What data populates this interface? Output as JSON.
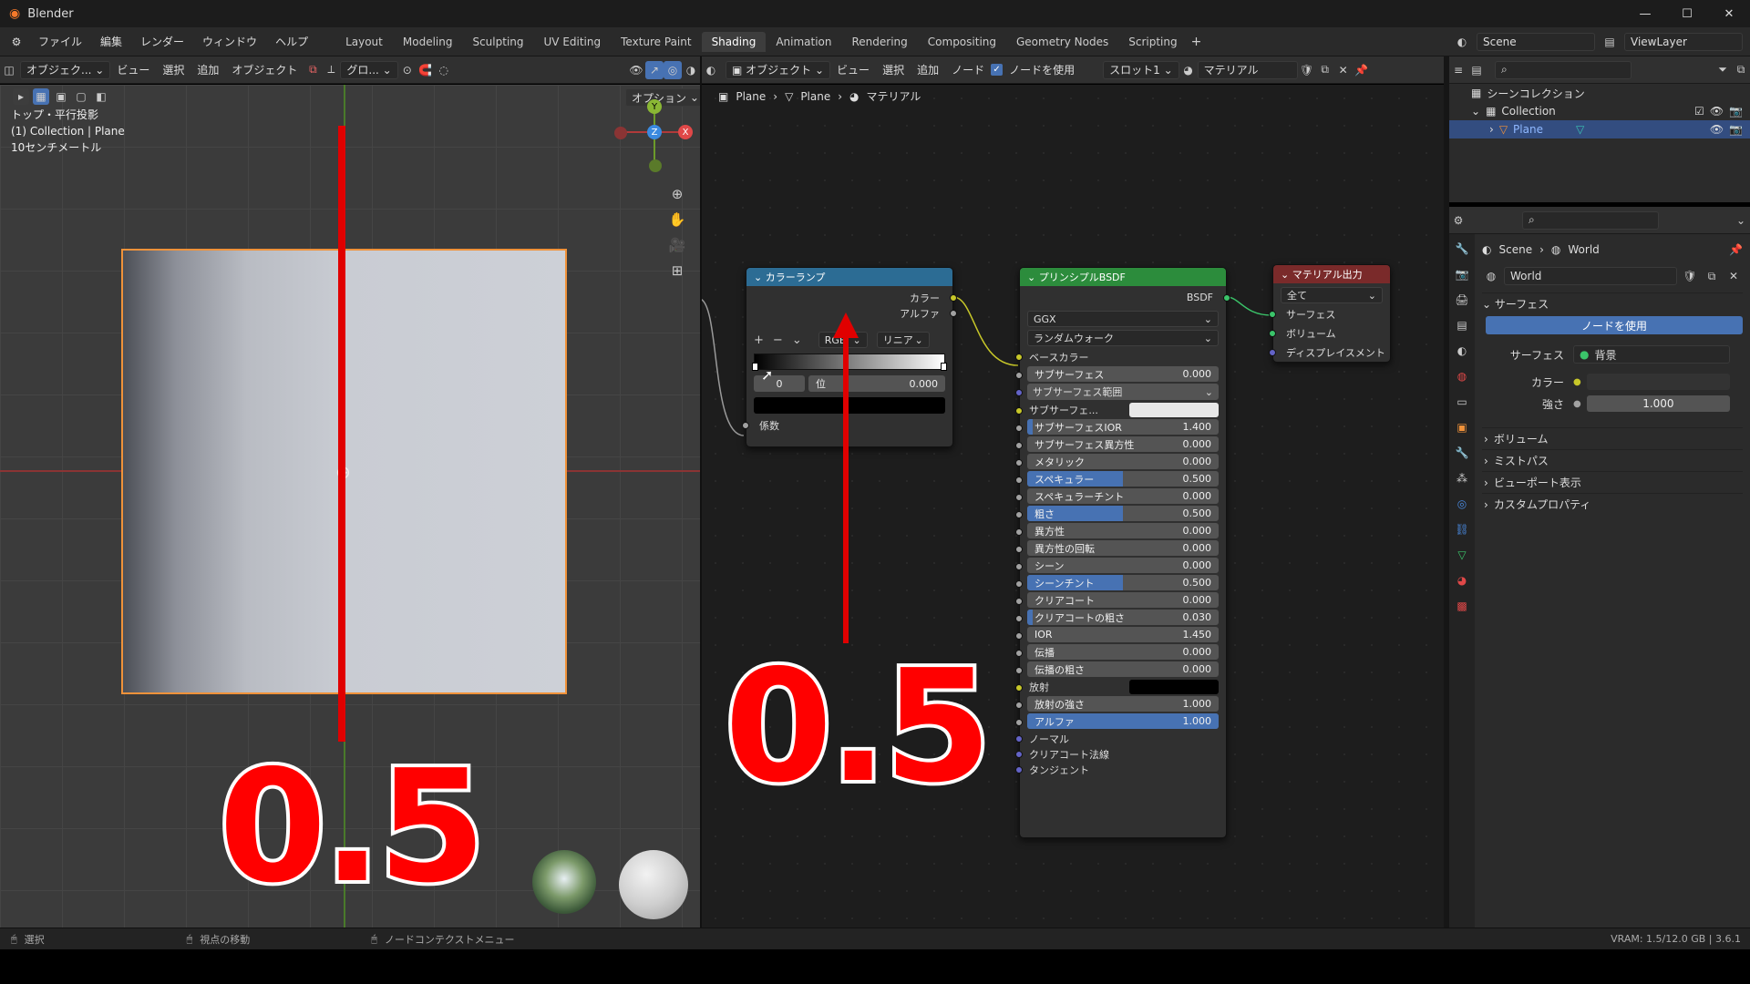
{
  "app_title": "Blender",
  "window_controls": {
    "minimize": "—",
    "maximize": "☐",
    "close": "✕"
  },
  "menu": {
    "items": [
      "ファイル",
      "編集",
      "レンダー",
      "ウィンドウ",
      "ヘルプ"
    ]
  },
  "workspace_tabs": [
    "Layout",
    "Modeling",
    "Sculpting",
    "UV Editing",
    "Texture Paint",
    "Shading",
    "Animation",
    "Rendering",
    "Compositing",
    "Geometry Nodes",
    "Scripting"
  ],
  "active_tab": "Shading",
  "add_tab": "+",
  "scene_name": "Scene",
  "view_layer": "ViewLayer",
  "viewport": {
    "header": {
      "mode": "オブジェク...",
      "view": "ビュー",
      "select": "選択",
      "add": "追加",
      "object": "オブジェクト",
      "transform": "グロ...",
      "options": "オプション"
    },
    "overlay_lines": [
      "トップ・平行投影",
      "(1) Collection | Plane",
      "10センチメートル"
    ],
    "gizmo": {
      "y": "Y",
      "z": "Z",
      "x": "X"
    },
    "annotation": "0.5"
  },
  "node_editor": {
    "header": {
      "object": "オブジェクト",
      "view": "ビュー",
      "select": "選択",
      "add": "追加",
      "node": "ノード",
      "use_nodes": "ノードを使用",
      "slot": "スロット1",
      "material": "マテリアル"
    },
    "breadcrumb": [
      "Plane",
      "Plane",
      "マテリアル"
    ],
    "annotation": "0.5",
    "color_ramp": {
      "title": "カラーランプ",
      "outputs": [
        "カラー",
        "アルファ"
      ],
      "controls": {
        "plus": "+",
        "minus": "−",
        "color_mode": "RGB",
        "interpolation": "リニア"
      },
      "stop_index": "0",
      "stop_pos_label": "位",
      "stop_pos_value": "0.000",
      "input": "係数"
    },
    "bsdf": {
      "title": "プリンシプルBSDF",
      "output": "BSDF",
      "distribution": "GGX",
      "subsurface_method": "ランダムウォーク",
      "base_color": "ベースカラー",
      "fields": [
        {
          "label": "サブサーフェス",
          "value": "0.000",
          "fill": 0
        },
        {
          "label": "サブサーフェス範囲",
          "value": "",
          "fill": 0,
          "dropdown": true
        },
        {
          "label": "サブサーフェ...",
          "value": "",
          "fill": 0,
          "swatch": "#e8e8e8"
        },
        {
          "label": "サブサーフェスIOR",
          "value": "1.400",
          "fill": 0.03
        },
        {
          "label": "サブサーフェス異方性",
          "value": "0.000",
          "fill": 0
        },
        {
          "label": "メタリック",
          "value": "0.000",
          "fill": 0
        },
        {
          "label": "スペキュラー",
          "value": "0.500",
          "fill": 0.5
        },
        {
          "label": "スペキュラーチント",
          "value": "0.000",
          "fill": 0
        },
        {
          "label": "粗さ",
          "value": "0.500",
          "fill": 0.5
        },
        {
          "label": "異方性",
          "value": "0.000",
          "fill": 0
        },
        {
          "label": "異方性の回転",
          "value": "0.000",
          "fill": 0
        },
        {
          "label": "シーン",
          "value": "0.000",
          "fill": 0
        },
        {
          "label": "シーンチント",
          "value": "0.500",
          "fill": 0.5
        },
        {
          "label": "クリアコート",
          "value": "0.000",
          "fill": 0
        },
        {
          "label": "クリアコートの粗さ",
          "value": "0.030",
          "fill": 0.03
        },
        {
          "label": "IOR",
          "value": "1.450",
          "fill": 0
        },
        {
          "label": "伝播",
          "value": "0.000",
          "fill": 0
        },
        {
          "label": "伝播の粗さ",
          "value": "0.000",
          "fill": 0
        },
        {
          "label": "放射",
          "value": "",
          "fill": 0,
          "swatch": "#000000"
        },
        {
          "label": "放射の強さ",
          "value": "1.000",
          "fill": 0
        },
        {
          "label": "アルファ",
          "value": "1.000",
          "fill": 1
        }
      ],
      "bottom_inputs": [
        "ノーマル",
        "クリアコート法線",
        "タンジェント"
      ]
    },
    "output": {
      "title": "マテリアル出力",
      "target": "全て",
      "inputs": [
        "サーフェス",
        "ボリューム",
        "ディスプレイスメント"
      ]
    }
  },
  "outliner": {
    "root": "シーンコレクション",
    "collection": "Collection",
    "object": "Plane"
  },
  "properties": {
    "breadcrumb": [
      "Scene",
      "World"
    ],
    "world_name": "World",
    "panel_surface": "サーフェス",
    "use_nodes": "ノードを使用",
    "surface_label": "サーフェス",
    "surface_value": "背景",
    "color_label": "カラー",
    "strength_label": "強さ",
    "strength_value": "1.000",
    "collapsed_panels": [
      "ボリューム",
      "ミストパス",
      "ビューポート表示",
      "カスタムプロパティ"
    ]
  },
  "status": {
    "select": "選択",
    "move_view": "視点の移動",
    "node_ctx": "ノードコンテクストメニュー",
    "vram": "VRAM: 1.5/12.0 GB | 3.6.1"
  },
  "colors": {
    "accent_blue": "#4772b3",
    "selection_orange": "#f0923a",
    "red_marker": "#e00000",
    "header_teal": "#2c6c94",
    "header_green": "#2c8c3c",
    "header_red": "#7a2a2a"
  }
}
